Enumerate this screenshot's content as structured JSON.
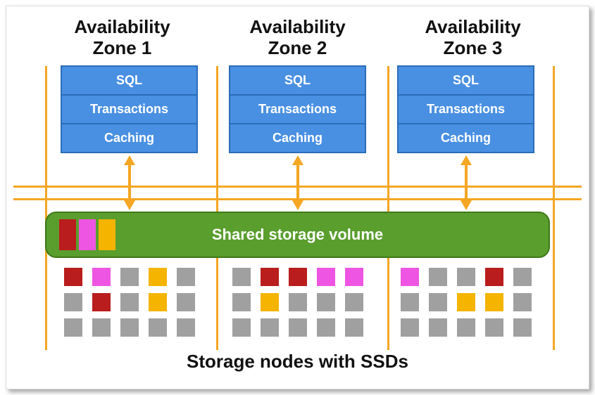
{
  "zones": [
    {
      "title": "Availability\nZone 1"
    },
    {
      "title": "Availability\nZone 2"
    },
    {
      "title": "Availability\nZone 3"
    }
  ],
  "db_layers": [
    "SQL",
    "Transactions",
    "Caching"
  ],
  "volume": {
    "label": "Shared storage volume",
    "blocks": [
      "red",
      "magenta",
      "yellow"
    ]
  },
  "node_groups": [
    [
      "red",
      "magenta",
      "gray",
      "yellow",
      "gray",
      "gray",
      "red",
      "gray",
      "yellow",
      "gray",
      "gray",
      "gray",
      "gray",
      "gray",
      "gray"
    ],
    [
      "gray",
      "red",
      "red",
      "magenta",
      "magenta",
      "gray",
      "yellow",
      "gray",
      "gray",
      "gray",
      "gray",
      "gray",
      "gray",
      "gray",
      "gray"
    ],
    [
      "magenta",
      "gray",
      "gray",
      "red",
      "gray",
      "gray",
      "gray",
      "yellow",
      "yellow",
      "gray",
      "gray",
      "gray",
      "gray",
      "gray",
      "gray"
    ]
  ],
  "footer": "Storage nodes with SSDs",
  "colors": {
    "red": "#b91d1d",
    "magenta": "#ee55e2",
    "yellow": "#f4b400",
    "gray": "#a0a0a0",
    "orange": "#f5a623",
    "blue": "#4a90e2",
    "green": "#5a9e2e"
  },
  "grid": {
    "vlines_x": [
      55,
      298,
      541,
      776
    ],
    "hlines_y": [
      255,
      273
    ]
  }
}
